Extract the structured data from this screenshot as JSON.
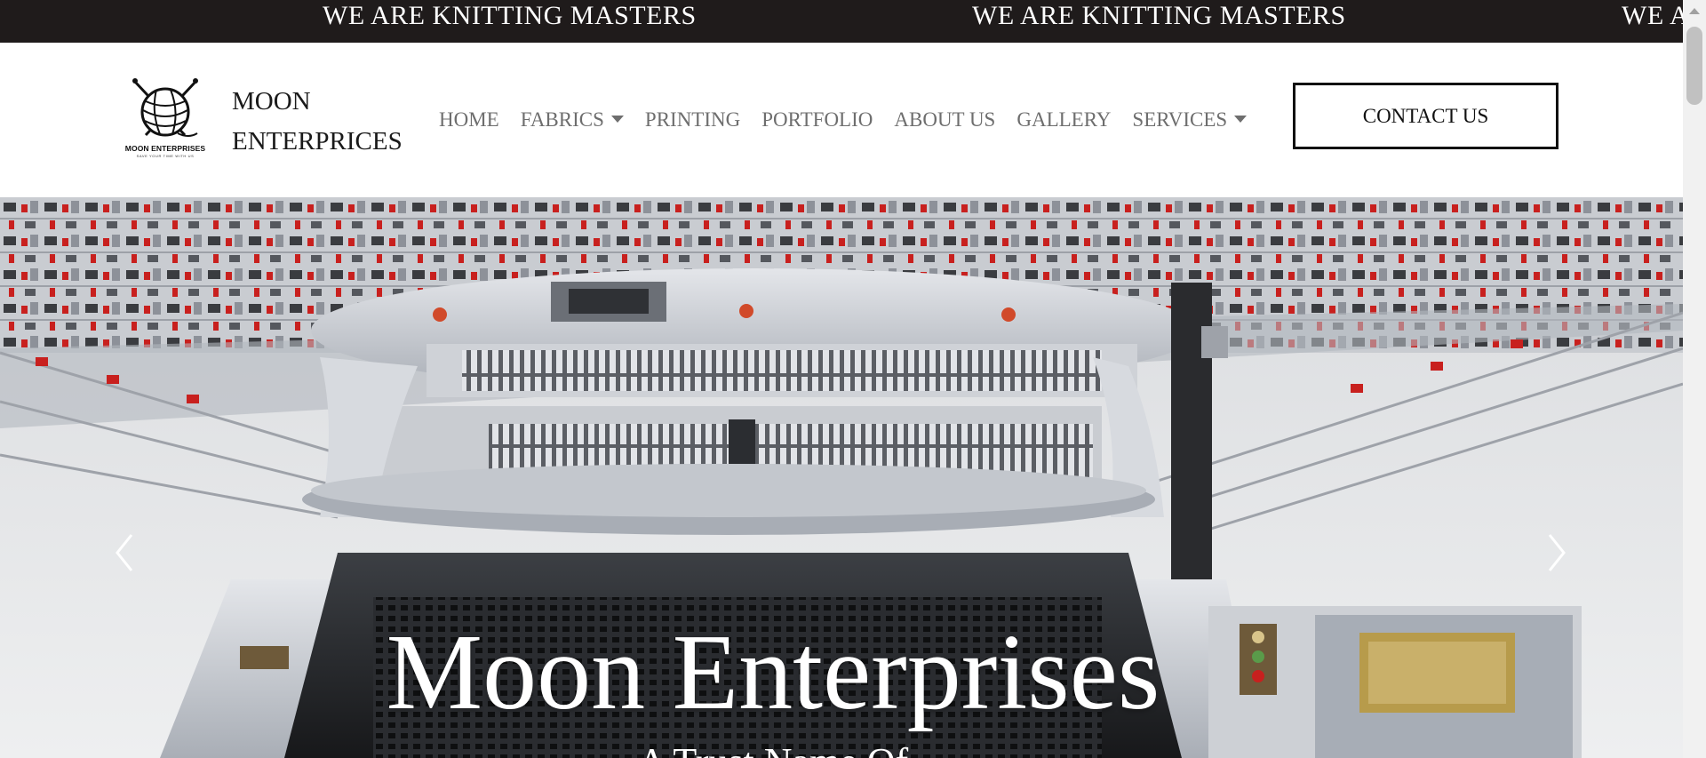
{
  "marquee": {
    "text_1": "WE ARE KNITTING MASTERS",
    "text_2": "WE ARE KNITTING MASTERS",
    "text_3": "WE A"
  },
  "header": {
    "logo_caption": "MOON ENTERPRISES",
    "logo_tagline": "SAVE YOUR TIME WITH US",
    "brand_line_1": "MOON",
    "brand_line_2": "ENTERPRICES",
    "nav": {
      "home": "HOME",
      "fabrics": "FABRICS",
      "printing": "PRINTING",
      "portfolio": "PORTFOLIO",
      "about": "ABOUT US",
      "gallery": "GALLERY",
      "services": "SERVICES"
    },
    "contact": "CONTACT US"
  },
  "hero": {
    "title": "Moon Enterprises",
    "subtitle": "A Trust Name Of",
    "prev_icon": "chevron-left-icon",
    "next_icon": "chevron-right-icon"
  },
  "colors": {
    "marquee_bg": "#1f1b1b",
    "nav_text": "#6e6e6e",
    "accent_red": "#c8201e",
    "machine_grey": "#b9bec6"
  }
}
